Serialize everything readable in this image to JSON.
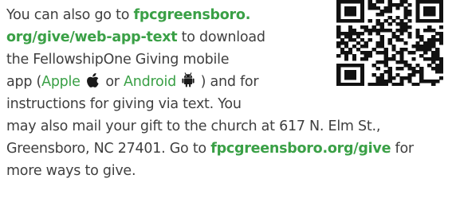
{
  "text": {
    "l1_a": "You can also go to ",
    "l1_link": "fpcgreensboro.",
    "l2_link": "org/give/web-app-text",
    "l2_b": " to download",
    "l3": "the FellowshipOne Giving mobile",
    "l4_a": "app (",
    "l4_apple": "Apple",
    "l4_or": " or ",
    "l4_android": "Android",
    "l4_b": " ) and for",
    "l5": "instructions for giving via text. You",
    "l6": "may also mail your gift to the church at 617 N. Elm St.,",
    "l7_a": "Greensboro, NC 27401. Go to ",
    "l7_link": "fpcgreensboro.org/give",
    "l7_b": " for",
    "l8": "more ways to give."
  },
  "icons": {
    "apple": "apple-logo-icon",
    "android": "android-logo-icon",
    "qr": "qr-code-icon"
  },
  "colors": {
    "text": "#3f3f3f",
    "link": "#3aa046"
  }
}
